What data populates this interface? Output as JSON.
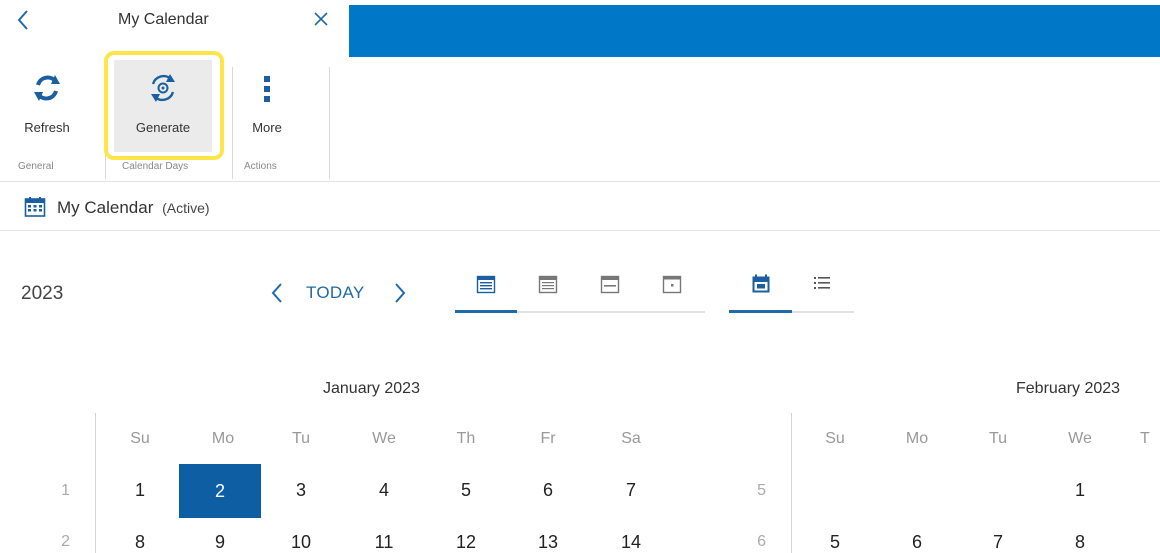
{
  "tab": {
    "title": "My Calendar"
  },
  "ribbon": {
    "refresh_label": "Refresh",
    "generate_label": "Generate",
    "more_label": "More",
    "groups": {
      "general": "General",
      "calendar_days": "Calendar Days",
      "actions": "Actions"
    }
  },
  "breadcrumb": {
    "title": "My Calendar",
    "status": "(Active)"
  },
  "toolbar": {
    "year": "2023",
    "today_label": "TODAY"
  },
  "calendar": {
    "weekday_headers": [
      "Su",
      "Mo",
      "Tu",
      "We",
      "Th",
      "Fr",
      "Sa"
    ],
    "january": {
      "title": "January 2023",
      "week_numbers": [
        "1",
        "2"
      ],
      "row1": [
        "1",
        "2",
        "3",
        "4",
        "5",
        "6",
        "7"
      ],
      "row2": [
        "8",
        "9",
        "10",
        "11",
        "12",
        "13",
        "14"
      ],
      "selected_day": "2"
    },
    "february": {
      "title": "February 2023",
      "weekday_headers": [
        "Su",
        "Mo",
        "Tu",
        "We",
        "T"
      ],
      "week_numbers": [
        "5",
        "6"
      ],
      "row1": [
        "1"
      ],
      "row2": [
        "5",
        "6",
        "7",
        "8"
      ]
    }
  },
  "colors": {
    "accent": "#0078c8",
    "selected": "#0e5ea3",
    "highlight": "#fde54a",
    "link": "#1f6ba8"
  }
}
